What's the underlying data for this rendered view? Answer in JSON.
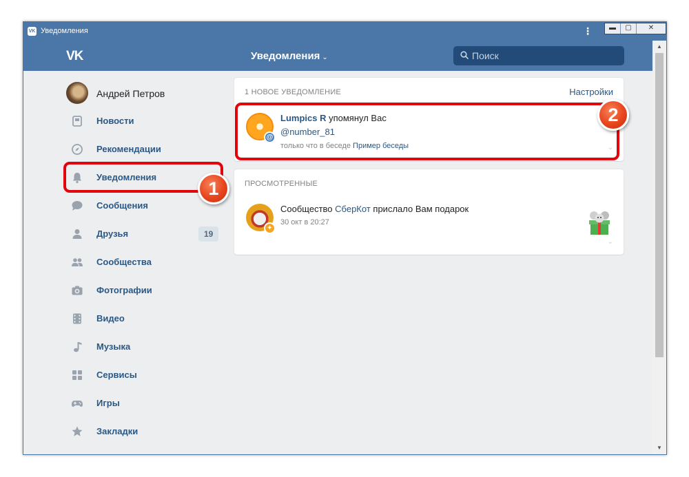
{
  "window": {
    "title": "Уведомления",
    "min_glyph": "▬",
    "max_glyph": "▢",
    "close_glyph": "✕",
    "menu_glyph": "⋮"
  },
  "header": {
    "logo": "VK",
    "section_title": "Уведомления",
    "search_placeholder": "Поиск"
  },
  "profile": {
    "name": "Андрей Петров"
  },
  "sidebar": {
    "items": [
      {
        "label": "Новости",
        "icon": "newspaper-icon"
      },
      {
        "label": "Рекомендации",
        "icon": "compass-icon"
      },
      {
        "label": "Уведомления",
        "icon": "bell-icon"
      },
      {
        "label": "Сообщения",
        "icon": "chat-bubble-icon"
      },
      {
        "label": "Друзья",
        "icon": "person-icon",
        "count": "19"
      },
      {
        "label": "Сообщества",
        "icon": "people-icon"
      },
      {
        "label": "Фотографии",
        "icon": "camera-icon"
      },
      {
        "label": "Видео",
        "icon": "film-icon"
      },
      {
        "label": "Музыка",
        "icon": "music-note-icon"
      },
      {
        "label": "Сервисы",
        "icon": "apps-icon"
      },
      {
        "label": "Игры",
        "icon": "gamepad-icon"
      },
      {
        "label": "Закладки",
        "icon": "star-icon"
      }
    ]
  },
  "new_notifications": {
    "header": "1 НОВОЕ УВЕДОМЛЕНИЕ",
    "settings_link": "Настройки",
    "item": {
      "author": "Lumpics R",
      "action": "упомянул Вас",
      "mention": "@number_81",
      "meta_prefix": "только что в беседе",
      "meta_link": "Пример беседы",
      "badge": "@"
    }
  },
  "viewed_notifications": {
    "header": "ПРОСМОТРЕННЫЕ",
    "item": {
      "prefix": "Сообщество",
      "community": "СберКот",
      "action": "прислало Вам подарок",
      "time": "30 окт в 20:27"
    }
  },
  "callouts": {
    "one": "1",
    "two": "2"
  },
  "colors": {
    "brand": "#4a76a8",
    "link": "#2a5885",
    "highlight": "#e2040c",
    "background": "#edeef0"
  }
}
